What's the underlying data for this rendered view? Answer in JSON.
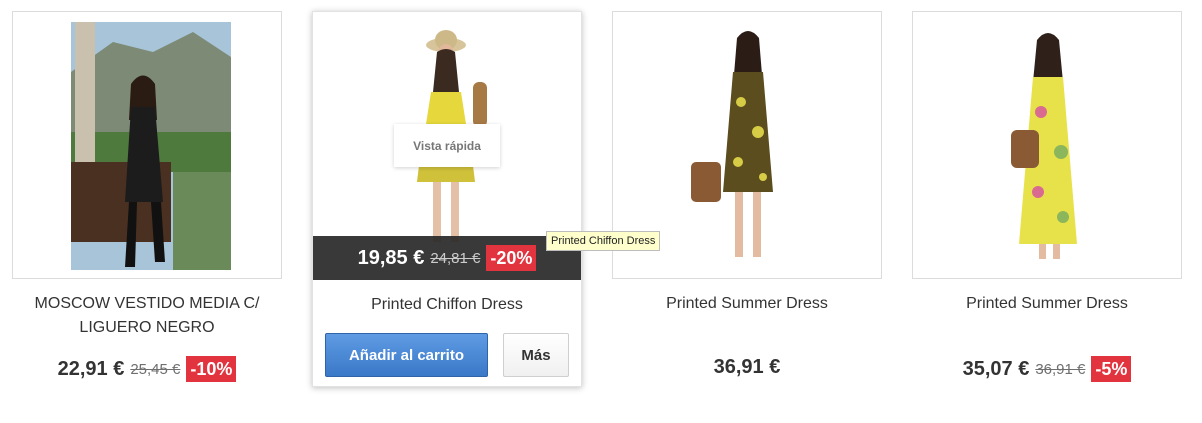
{
  "products": [
    {
      "name": "MOSCOW VESTIDO MEDIA C/ LIGUERO NEGRO",
      "price": "22,91 €",
      "old_price": "25,45 €",
      "discount": "-10%"
    },
    {
      "name": "Printed Chiffon Dress",
      "price": "19,85 €",
      "old_price": "24,81 €",
      "discount": "-20%",
      "quick_view_label": "Vista rápida",
      "add_to_cart_label": "Añadir al carrito",
      "more_label": "Más",
      "tooltip": "Printed Chiffon Dress"
    },
    {
      "name": "Printed Summer Dress",
      "price": "36,91 €"
    },
    {
      "name": "Printed Summer Dress",
      "price": "35,07 €",
      "old_price": "36,91 €",
      "discount": "-5%"
    }
  ],
  "colors": {
    "discount_badge": "#e2343f",
    "cart_button": "#3a78c8",
    "price_overlay": "#282828"
  }
}
